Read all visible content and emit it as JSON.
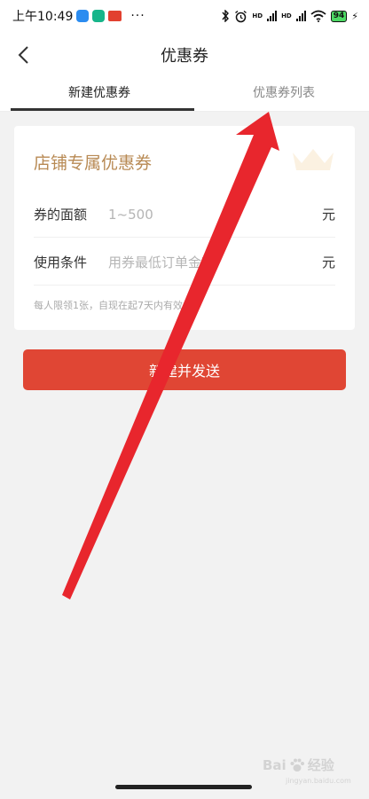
{
  "status_bar": {
    "time": "上午10:49",
    "more": "···",
    "hd1": "HD",
    "hd2": "HD",
    "battery": "94"
  },
  "header": {
    "title": "优惠券"
  },
  "tabs": [
    {
      "label": "新建优惠券",
      "active": true
    },
    {
      "label": "优惠券列表",
      "active": false
    }
  ],
  "coupon_card": {
    "title": "店铺专属优惠券",
    "fields": [
      {
        "label": "券的面额",
        "placeholder": "1~500",
        "unit": "元"
      },
      {
        "label": "使用条件",
        "placeholder": "用券最低订单金额",
        "unit": "元"
      }
    ],
    "hint": "每人限领1张，自现在起7天内有效"
  },
  "actions": {
    "submit_label": "新建并发送"
  },
  "watermark": {
    "text": "Bai",
    "text2": "经验",
    "sub": "jingyan.baidu.com"
  },
  "colors": {
    "accent": "#e04634",
    "card_title": "#b88a54",
    "annotation_arrow": "#e8262d"
  }
}
